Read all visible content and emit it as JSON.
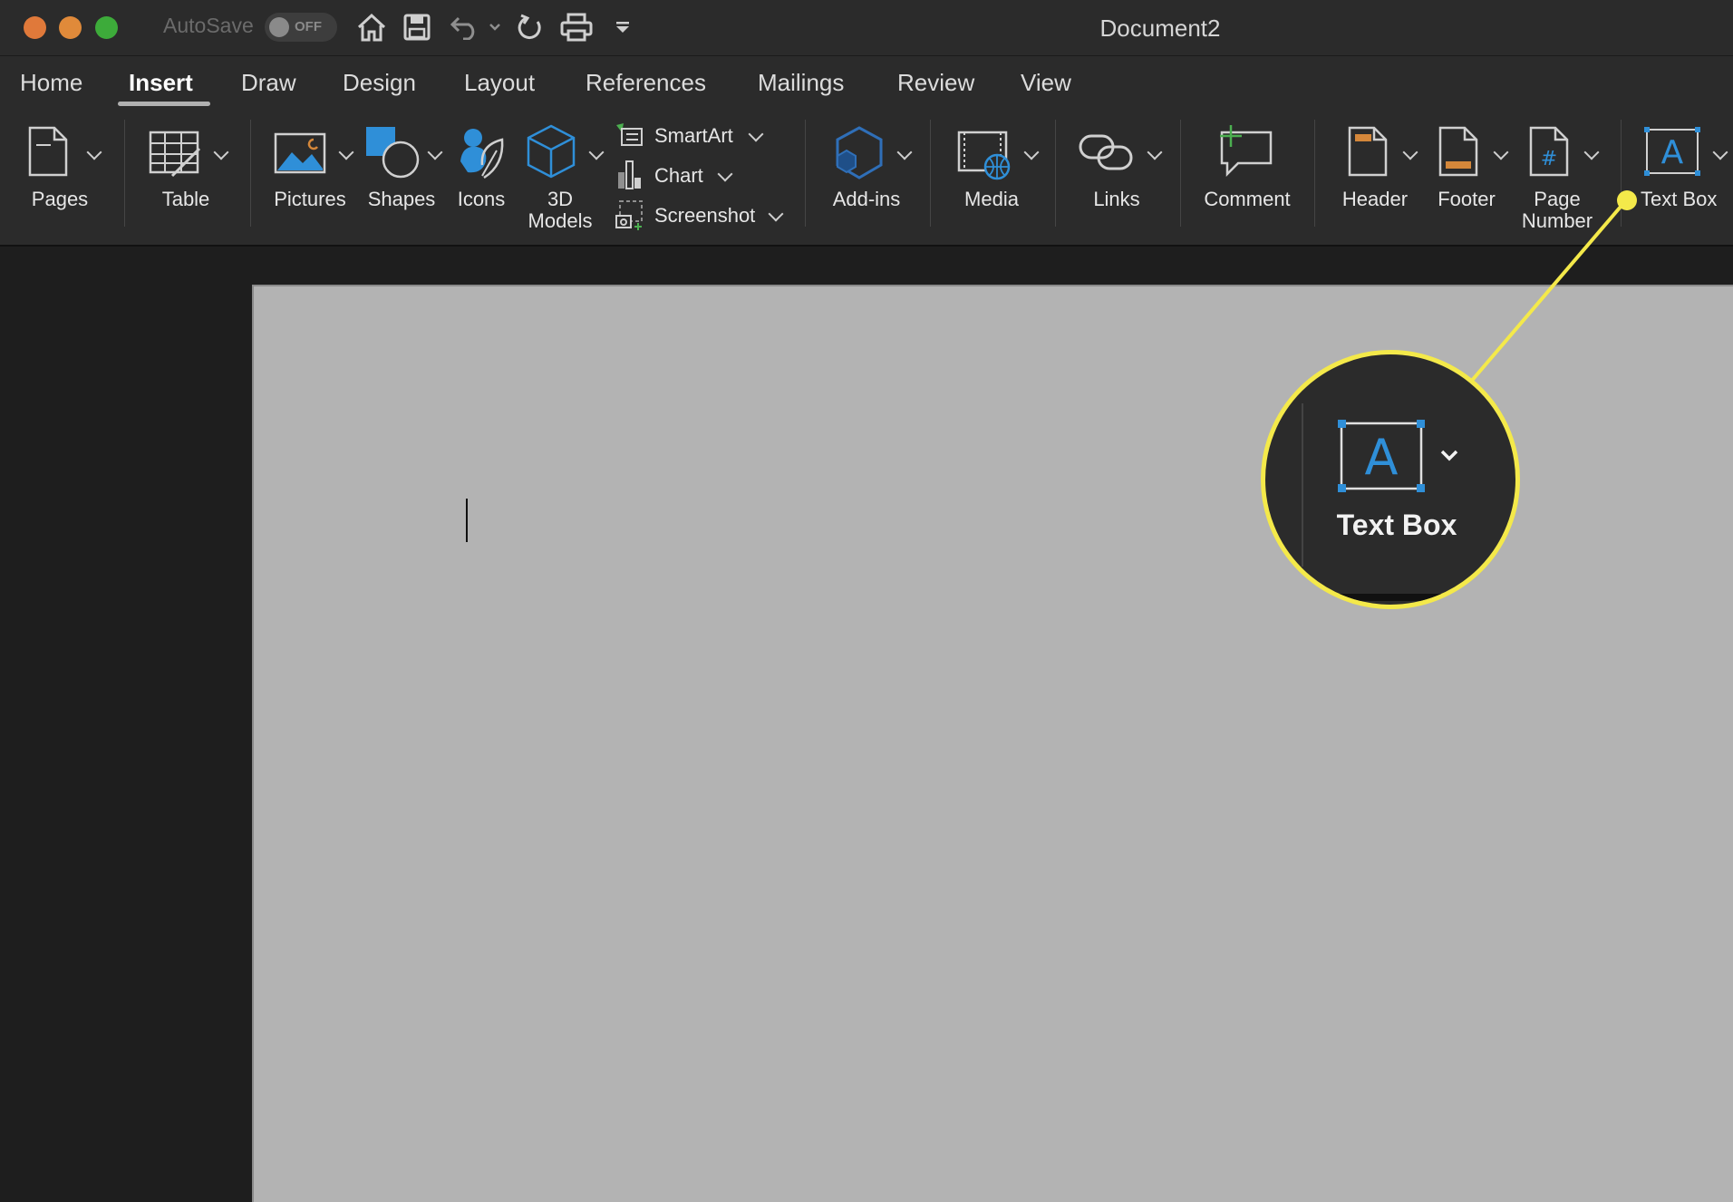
{
  "titlebar": {
    "autosave_label": "AutoSave",
    "autosave_state": "OFF",
    "document_title": "Document2",
    "traffic_colors": {
      "close": "#e0793a",
      "minimize": "#e08a3a",
      "maximize": "#3dab3a"
    }
  },
  "tabs": [
    "Home",
    "Insert",
    "Draw",
    "Design",
    "Layout",
    "References",
    "Mailings",
    "Review",
    "View"
  ],
  "active_tab": "Insert",
  "ribbon": {
    "pages": "Pages",
    "table": "Table",
    "pictures": "Pictures",
    "shapes": "Shapes",
    "icons": "Icons",
    "models_line1": "3D",
    "models_line2": "Models",
    "smartart": "SmartArt",
    "chart": "Chart",
    "screenshot": "Screenshot",
    "addins": "Add-ins",
    "media": "Media",
    "links": "Links",
    "comment": "Comment",
    "header": "Header",
    "footer": "Footer",
    "page_number_line1": "Page",
    "page_number_line2": "Number",
    "text_box": "Text Box"
  },
  "callout": {
    "label": "Text Box",
    "highlight_color": "#f4e94a"
  },
  "colors": {
    "accent_blue": "#2f8fd8",
    "accent_orange": "#d4873a",
    "accent_green": "#4caf50"
  }
}
